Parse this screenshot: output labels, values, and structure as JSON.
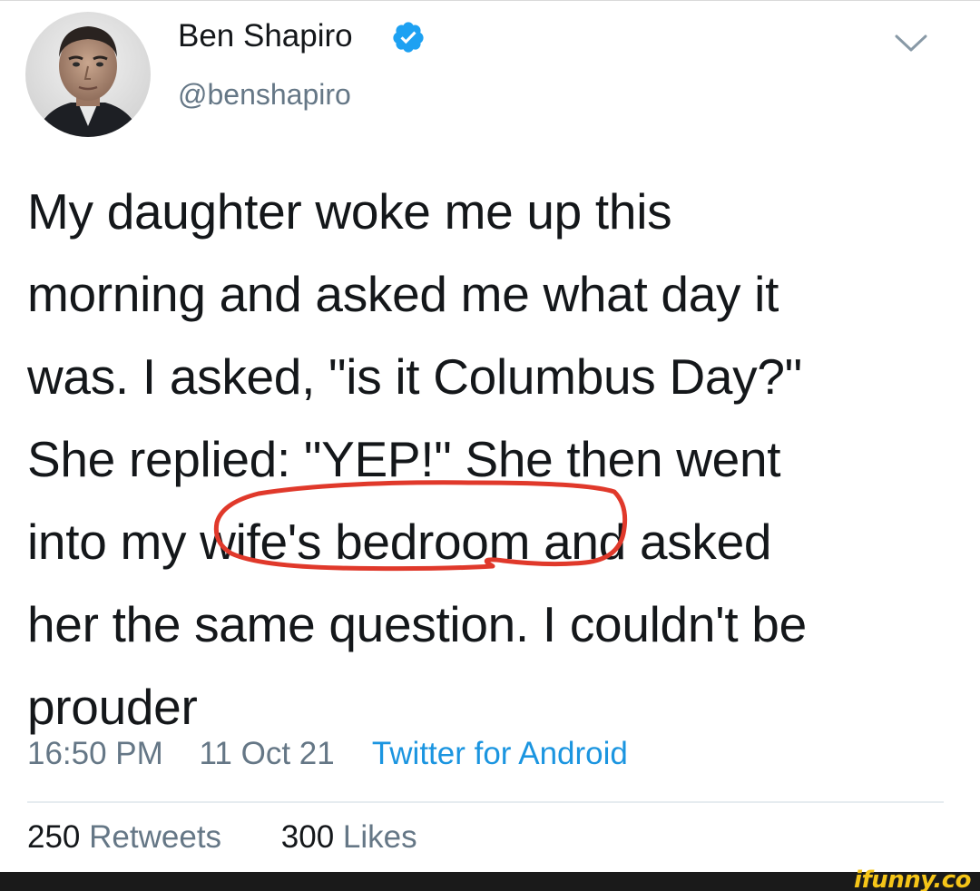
{
  "author": {
    "display_name": "Ben Shapiro",
    "handle": "@benshapiro",
    "verified": true,
    "avatar": "profile-photo"
  },
  "menu_icon": "chevron-down-icon",
  "tweet": {
    "lines": [
      "My daughter woke me up this",
      "morning and asked me what day it",
      "was. I asked, \"is it Columbus Day?\"",
      "She replied: \"YEP!\" She then went",
      "into my wife's bedroom and asked",
      "her the same question. I couldn't be",
      "prouder"
    ],
    "annotation": {
      "type": "hand-drawn red circle",
      "highlighted_text": "wife's bedroom",
      "color": "#e0392b"
    }
  },
  "meta": {
    "time": "16:50 PM",
    "date": "11 Oct 21",
    "source": "Twitter for Android"
  },
  "stats": {
    "retweets_count": "250",
    "retweets_label": "Retweets",
    "likes_count": "300",
    "likes_label": "Likes"
  },
  "watermark": {
    "text": "ifunny.co",
    "color": "#f5c518"
  },
  "colors": {
    "text_primary": "#14171a",
    "text_secondary": "#657786",
    "link": "#1b95e0",
    "verified_badge": "#1da1f2",
    "divider": "#e6ecf0"
  }
}
